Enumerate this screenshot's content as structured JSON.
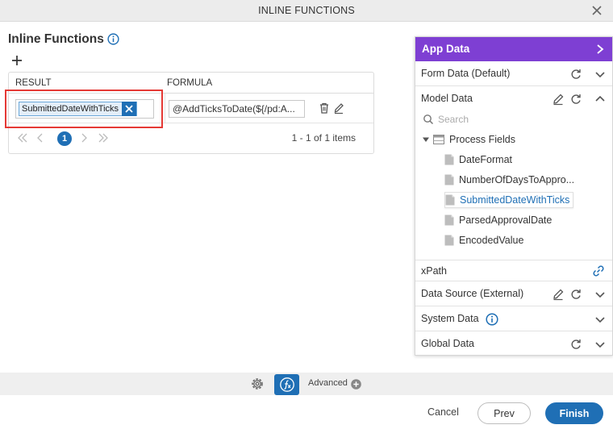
{
  "dialog": {
    "title": "INLINE FUNCTIONS"
  },
  "main": {
    "heading": "Inline Functions",
    "grid": {
      "columns": [
        "RESULT",
        "FORMULA"
      ],
      "rows": [
        {
          "result": "SubmittedDateWithTicks",
          "formula": "@AddTicksToDate(${/pd:A..."
        }
      ],
      "pager": {
        "current_page": "1",
        "info": "1 - 1 of 1 items"
      }
    }
  },
  "panel": {
    "title": "App Data",
    "sections": {
      "form_data": "Form Data (Default)",
      "model_data": "Model Data",
      "data_source": "Data Source (External)",
      "system_data": "System Data",
      "global_data": "Global Data"
    },
    "search_placeholder": "Search",
    "tree": {
      "root": "Process Fields",
      "items": [
        "DateFormat",
        "NumberOfDaysToAppro...",
        "SubmittedDateWithTicks",
        "ParsedApprovalDate",
        "EncodedValue"
      ],
      "selected": "SubmittedDateWithTicks"
    },
    "xpath_label": "xPath"
  },
  "footer": {
    "advanced_label": "Advanced",
    "cancel": "Cancel",
    "prev": "Prev",
    "finish": "Finish"
  },
  "colors": {
    "accent": "#1f6fb5",
    "panel_header": "#7e3fd3",
    "highlight": "#e53935"
  }
}
